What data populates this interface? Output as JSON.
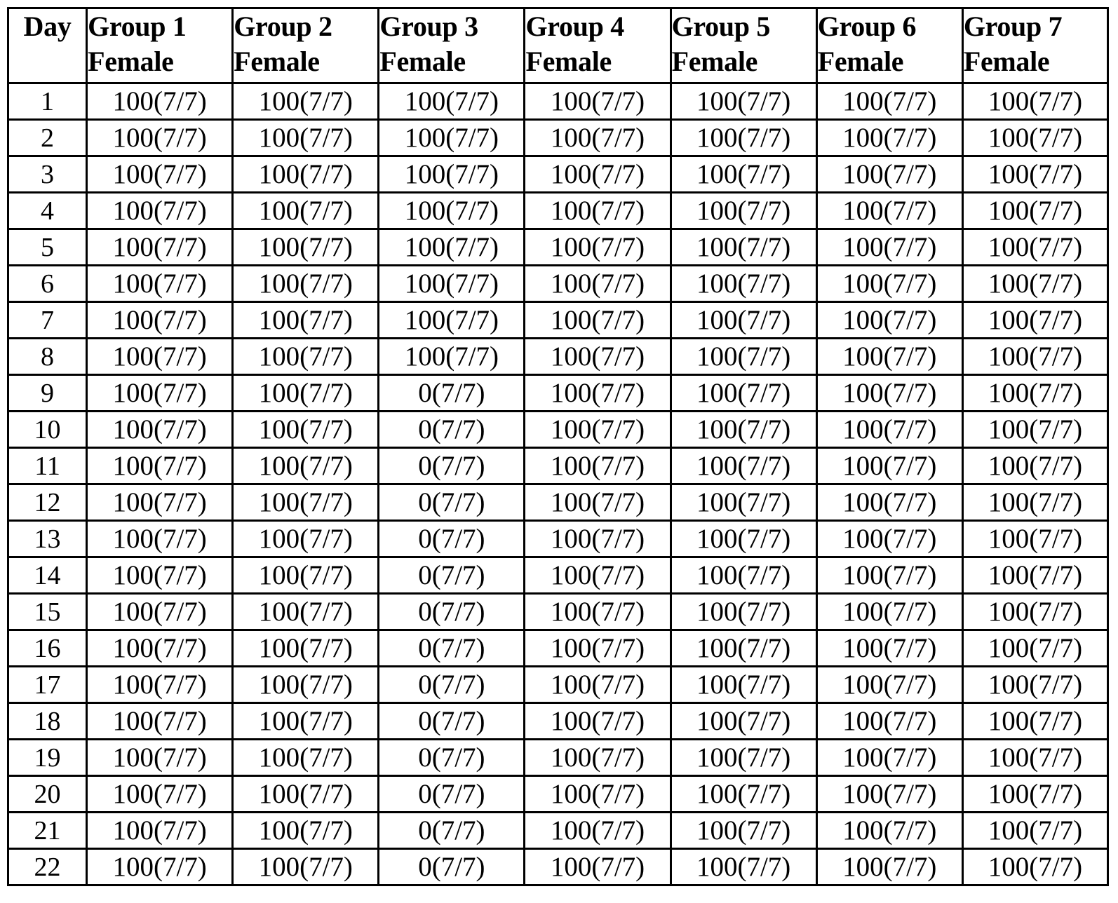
{
  "table": {
    "name": "female-survival-by-day-and-group",
    "columns": [
      {
        "id": "day",
        "line1": "Day",
        "line2": ""
      },
      {
        "id": "group1",
        "line1": "Group 1",
        "line2": "Female"
      },
      {
        "id": "group2",
        "line1": "Group 2",
        "line2": "Female"
      },
      {
        "id": "group3",
        "line1": "Group 3",
        "line2": "Female"
      },
      {
        "id": "group4",
        "line1": "Group 4",
        "line2": "Female"
      },
      {
        "id": "group5",
        "line1": "Group 5",
        "line2": "Female"
      },
      {
        "id": "group6",
        "line1": "Group 6",
        "line2": "Female"
      },
      {
        "id": "group7",
        "line1": "Group 7",
        "line2": "Female"
      }
    ],
    "rows": [
      {
        "day": "1",
        "cells": [
          "100(7/7)",
          "100(7/7)",
          "100(7/7)",
          "100(7/7)",
          "100(7/7)",
          "100(7/7)",
          "100(7/7)"
        ]
      },
      {
        "day": "2",
        "cells": [
          "100(7/7)",
          "100(7/7)",
          "100(7/7)",
          "100(7/7)",
          "100(7/7)",
          "100(7/7)",
          "100(7/7)"
        ]
      },
      {
        "day": "3",
        "cells": [
          "100(7/7)",
          "100(7/7)",
          "100(7/7)",
          "100(7/7)",
          "100(7/7)",
          "100(7/7)",
          "100(7/7)"
        ]
      },
      {
        "day": "4",
        "cells": [
          "100(7/7)",
          "100(7/7)",
          "100(7/7)",
          "100(7/7)",
          "100(7/7)",
          "100(7/7)",
          "100(7/7)"
        ]
      },
      {
        "day": "5",
        "cells": [
          "100(7/7)",
          "100(7/7)",
          "100(7/7)",
          "100(7/7)",
          "100(7/7)",
          "100(7/7)",
          "100(7/7)"
        ]
      },
      {
        "day": "6",
        "cells": [
          "100(7/7)",
          "100(7/7)",
          "100(7/7)",
          "100(7/7)",
          "100(7/7)",
          "100(7/7)",
          "100(7/7)"
        ]
      },
      {
        "day": "7",
        "cells": [
          "100(7/7)",
          "100(7/7)",
          "100(7/7)",
          "100(7/7)",
          "100(7/7)",
          "100(7/7)",
          "100(7/7)"
        ]
      },
      {
        "day": "8",
        "cells": [
          "100(7/7)",
          "100(7/7)",
          "100(7/7)",
          "100(7/7)",
          "100(7/7)",
          "100(7/7)",
          "100(7/7)"
        ]
      },
      {
        "day": "9",
        "cells": [
          "100(7/7)",
          "100(7/7)",
          "0(7/7)",
          "100(7/7)",
          "100(7/7)",
          "100(7/7)",
          "100(7/7)"
        ]
      },
      {
        "day": "10",
        "cells": [
          "100(7/7)",
          "100(7/7)",
          "0(7/7)",
          "100(7/7)",
          "100(7/7)",
          "100(7/7)",
          "100(7/7)"
        ]
      },
      {
        "day": "11",
        "cells": [
          "100(7/7)",
          "100(7/7)",
          "0(7/7)",
          "100(7/7)",
          "100(7/7)",
          "100(7/7)",
          "100(7/7)"
        ]
      },
      {
        "day": "12",
        "cells": [
          "100(7/7)",
          "100(7/7)",
          "0(7/7)",
          "100(7/7)",
          "100(7/7)",
          "100(7/7)",
          "100(7/7)"
        ]
      },
      {
        "day": "13",
        "cells": [
          "100(7/7)",
          "100(7/7)",
          "0(7/7)",
          "100(7/7)",
          "100(7/7)",
          "100(7/7)",
          "100(7/7)"
        ]
      },
      {
        "day": "14",
        "cells": [
          "100(7/7)",
          "100(7/7)",
          "0(7/7)",
          "100(7/7)",
          "100(7/7)",
          "100(7/7)",
          "100(7/7)"
        ]
      },
      {
        "day": "15",
        "cells": [
          "100(7/7)",
          "100(7/7)",
          "0(7/7)",
          "100(7/7)",
          "100(7/7)",
          "100(7/7)",
          "100(7/7)"
        ]
      },
      {
        "day": "16",
        "cells": [
          "100(7/7)",
          "100(7/7)",
          "0(7/7)",
          "100(7/7)",
          "100(7/7)",
          "100(7/7)",
          "100(7/7)"
        ]
      },
      {
        "day": "17",
        "cells": [
          "100(7/7)",
          "100(7/7)",
          "0(7/7)",
          "100(7/7)",
          "100(7/7)",
          "100(7/7)",
          "100(7/7)"
        ]
      },
      {
        "day": "18",
        "cells": [
          "100(7/7)",
          "100(7/7)",
          "0(7/7)",
          "100(7/7)",
          "100(7/7)",
          "100(7/7)",
          "100(7/7)"
        ]
      },
      {
        "day": "19",
        "cells": [
          "100(7/7)",
          "100(7/7)",
          "0(7/7)",
          "100(7/7)",
          "100(7/7)",
          "100(7/7)",
          "100(7/7)"
        ]
      },
      {
        "day": "20",
        "cells": [
          "100(7/7)",
          "100(7/7)",
          "0(7/7)",
          "100(7/7)",
          "100(7/7)",
          "100(7/7)",
          "100(7/7)"
        ]
      },
      {
        "day": "21",
        "cells": [
          "100(7/7)",
          "100(7/7)",
          "0(7/7)",
          "100(7/7)",
          "100(7/7)",
          "100(7/7)",
          "100(7/7)"
        ]
      },
      {
        "day": "22",
        "cells": [
          "100(7/7)",
          "100(7/7)",
          "0(7/7)",
          "100(7/7)",
          "100(7/7)",
          "100(7/7)",
          "100(7/7)"
        ]
      }
    ]
  },
  "colors": {
    "border": "#000000",
    "text": "#000000",
    "background": "#ffffff"
  }
}
